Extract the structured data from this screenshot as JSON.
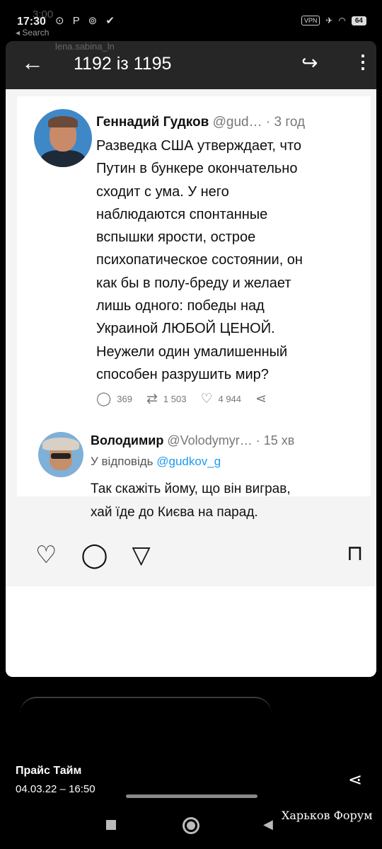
{
  "status_bar": {
    "ghost_time": "3:00",
    "time": "17:30",
    "icons": "⊙ P ⊚ ✔",
    "back_label": "◂ Search",
    "vpn": "VPN",
    "battery": "64"
  },
  "gallery_bar": {
    "ghost_user": "lena.sabina_ln",
    "counter": "1192 із 1195",
    "back_icon": "←",
    "share_icon": "↪",
    "more_icon": "⋮"
  },
  "tweet": {
    "author_name": "Геннадий Гудков",
    "author_handle": "@gud…",
    "time": "· 3 год",
    "text": "Разведка США утверждает, что\nПутин в бункере окончательно\nсходит с ума. У него\nнаблюдаются спонтанные\nвспышки ярости, острое\nпсихопатическое состоянии, он\nкак бы в полу-бреду и желает\nлишь одного: победы над\nУкраиной ЛЮБОЙ ЦЕНОЙ.\nНеужели один умалишенный\nспособен разрушить мир?",
    "replies": "369",
    "retweets": "1 503",
    "likes": "4 944"
  },
  "reply": {
    "author_name": "Володимир",
    "author_handle": "@Volodymyr…",
    "time": "· 15 хв",
    "reply_to_prefix": "У відповідь",
    "reply_to_handle": "@gudkov_g",
    "text": "Так скажіть йому, що він виграв,\nхай їде до Києва на парад."
  },
  "post_actions": {
    "like_icon": "♡",
    "comment_icon": "◯",
    "send_icon": "▽",
    "save_icon": "⊓"
  },
  "caption": {
    "title": "Прайс Тайм",
    "date": "04.03.22 – 16:50",
    "watermark": "Харьков Форум"
  }
}
